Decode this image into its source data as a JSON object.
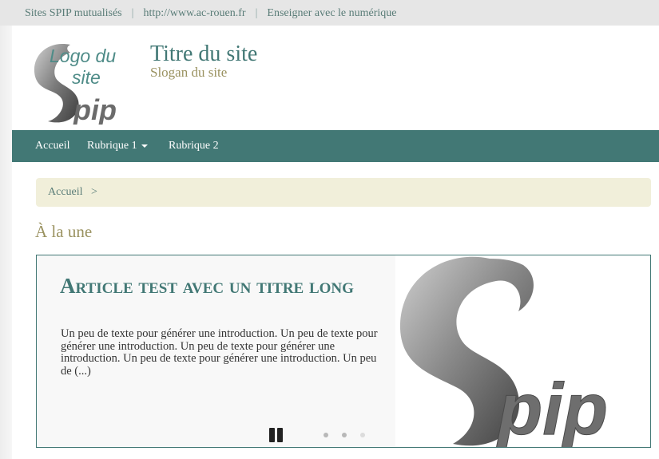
{
  "topbar": {
    "link1": "Sites SPIP mutualisés",
    "link2": "http://www.ac-rouen.fr",
    "link3": "Enseigner avec le numérique",
    "separator": "|"
  },
  "header": {
    "logo_text_line1": "Logo du",
    "logo_text_line2": "site",
    "logo_brand": "pip",
    "title": "Titre du site",
    "slogan": "Slogan du site"
  },
  "nav": {
    "items": [
      "Accueil",
      "Rubrique 1",
      "Rubrique 2"
    ]
  },
  "breadcrumb": {
    "home": "Accueil",
    "separator": ">"
  },
  "section": {
    "title": "À la une"
  },
  "carousel": {
    "article_title": "Article test avec un titre long",
    "article_intro": "Un peu de texte pour générer une introduction. Un peu de texte pour générer une introduction. Un peu de texte pour générer une introduction. Un peu de texte pour générer une introduction. Un peu de (...)",
    "image_brand": "pip",
    "slide_count": 3,
    "active_slide": 1
  },
  "colors": {
    "accent": "#427875",
    "slogan": "#9a9260",
    "breadcrumb_bg": "#f1efda"
  }
}
